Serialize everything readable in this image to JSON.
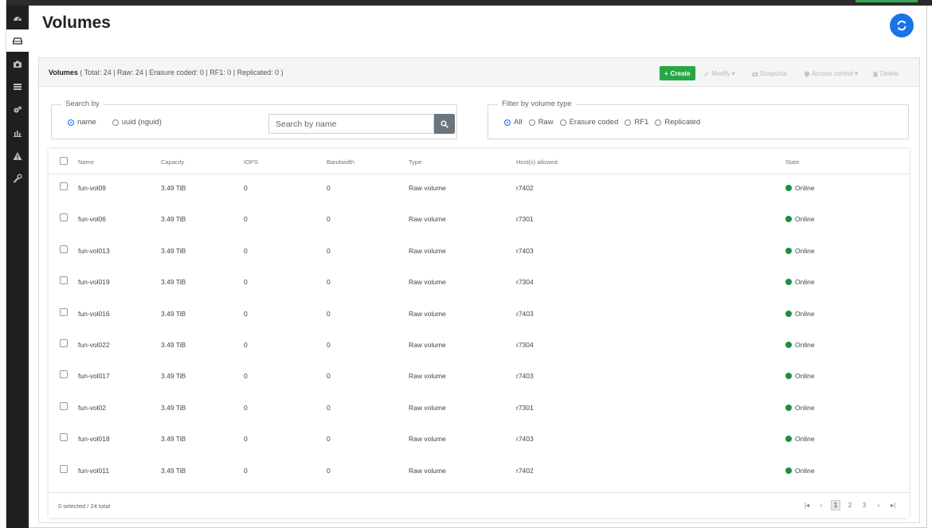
{
  "page": {
    "title": "Volumes"
  },
  "panel": {
    "title_bold": "Volumes",
    "title_rest": " ( Total: 24 | Raw: 24 | Erasure coded: 0 | RF1: 0 | Replicated: 0 )"
  },
  "toolbar": {
    "create": "Create",
    "modify": "Modify",
    "snapshot": "Snapshot",
    "access_control": "Access control",
    "delete": "Delete"
  },
  "search": {
    "legend": "Search by",
    "options": [
      "name",
      "uuid (nguid)"
    ],
    "selected": "name",
    "placeholder": "Search by name"
  },
  "filter": {
    "legend": "Filter by volume type",
    "options": [
      "All",
      "Raw",
      "Erasure coded",
      "RF1",
      "Replicated"
    ],
    "selected": "All"
  },
  "table": {
    "columns": [
      "Name",
      "Capacity",
      "IOPS",
      "Bandwidth",
      "Type",
      "Host(s) allowed",
      "State"
    ],
    "rows": [
      {
        "name": "fun-vol09",
        "capacity": "3.49 TiB",
        "iops": "0",
        "bandwidth": "0",
        "type": "Raw volume",
        "hosts": "r7402",
        "state": "Online"
      },
      {
        "name": "fun-vol06",
        "capacity": "3.49 TiB",
        "iops": "0",
        "bandwidth": "0",
        "type": "Raw volume",
        "hosts": "r7301",
        "state": "Online"
      },
      {
        "name": "fun-vol013",
        "capacity": "3.49 TiB",
        "iops": "0",
        "bandwidth": "0",
        "type": "Raw volume",
        "hosts": "r7403",
        "state": "Online"
      },
      {
        "name": "fun-vol019",
        "capacity": "3.49 TiB",
        "iops": "0",
        "bandwidth": "0",
        "type": "Raw volume",
        "hosts": "r7304",
        "state": "Online"
      },
      {
        "name": "fun-vol016",
        "capacity": "3.49 TiB",
        "iops": "0",
        "bandwidth": "0",
        "type": "Raw volume",
        "hosts": "r7403",
        "state": "Online"
      },
      {
        "name": "fun-vol022",
        "capacity": "3.49 TiB",
        "iops": "0",
        "bandwidth": "0",
        "type": "Raw volume",
        "hosts": "r7304",
        "state": "Online"
      },
      {
        "name": "fun-vol017",
        "capacity": "3.49 TiB",
        "iops": "0",
        "bandwidth": "0",
        "type": "Raw volume",
        "hosts": "r7403",
        "state": "Online"
      },
      {
        "name": "fun-vol02",
        "capacity": "3.49 TiB",
        "iops": "0",
        "bandwidth": "0",
        "type": "Raw volume",
        "hosts": "r7301",
        "state": "Online"
      },
      {
        "name": "fun-vol018",
        "capacity": "3.49 TiB",
        "iops": "0",
        "bandwidth": "0",
        "type": "Raw volume",
        "hosts": "r7403",
        "state": "Online"
      },
      {
        "name": "fun-vol011",
        "capacity": "3.49 TiB",
        "iops": "0",
        "bandwidth": "0",
        "type": "Raw volume",
        "hosts": "r7402",
        "state": "Online"
      }
    ],
    "footer": "0 selected / 24 total"
  },
  "pager": {
    "pages": [
      "1",
      "2",
      "3"
    ],
    "current": "1"
  },
  "colors": {
    "accent": "#1a73e8",
    "create": "#28a745",
    "online": "#1e8e3e",
    "sidebar": "#1f1f1f"
  },
  "icons": {
    "sidebar": [
      "dashboard-icon",
      "drive-icon",
      "camera-icon",
      "server-icon",
      "cogs-icon",
      "chart-icon",
      "warning-icon",
      "wrench-icon"
    ],
    "refresh": "refresh-icon",
    "search": "search-icon"
  }
}
